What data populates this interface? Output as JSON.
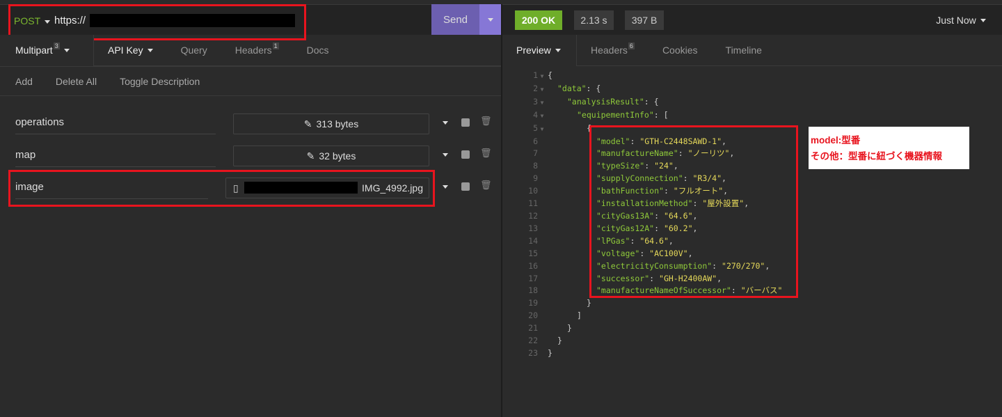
{
  "request": {
    "method": "POST",
    "url": "https://",
    "send_label": "Send"
  },
  "response_meta": {
    "status": "200 OK",
    "time": "2.13 s",
    "size": "397 B",
    "history": "Just Now",
    "status_color": "#6fae2a"
  },
  "request_tabs": [
    {
      "label": "Multipart",
      "count": "3"
    },
    {
      "label": "API Key"
    },
    {
      "label": "Query"
    },
    {
      "label": "Headers",
      "count": "1"
    },
    {
      "label": "Docs"
    }
  ],
  "response_tabs": [
    {
      "label": "Preview"
    },
    {
      "label": "Headers",
      "count": "6"
    },
    {
      "label": "Cookies"
    },
    {
      "label": "Timeline"
    }
  ],
  "toolbar": {
    "add": "Add",
    "delete_all": "Delete All",
    "toggle_description": "Toggle Description"
  },
  "params": [
    {
      "name": "operations",
      "value": "313 bytes"
    },
    {
      "name": "map",
      "value": "32 bytes"
    },
    {
      "name": "image",
      "value": "IMG_4992.jpg"
    }
  ],
  "code_lines": [
    {
      "n": "1",
      "f": 1,
      "ind": 0,
      "p": "{"
    },
    {
      "n": "2",
      "f": 1,
      "ind": 1,
      "k": "\"data\"",
      "p": ": {"
    },
    {
      "n": "3",
      "f": 1,
      "ind": 2,
      "k": "\"analysisResult\"",
      "p": ": {"
    },
    {
      "n": "4",
      "f": 1,
      "ind": 3,
      "k": "\"equipementInfo\"",
      "p": ": ["
    },
    {
      "n": "5",
      "f": 1,
      "ind": 4,
      "p": "{"
    },
    {
      "n": "6",
      "ind": 5,
      "k": "\"model\"",
      "v": "\"GTH-C2448SAWD-1\"",
      "p2": ","
    },
    {
      "n": "7",
      "ind": 5,
      "k": "\"manufactureName\"",
      "v": "\"ノーリツ\"",
      "p2": ","
    },
    {
      "n": "8",
      "ind": 5,
      "k": "\"typeSize\"",
      "v": "\"24\"",
      "p2": ","
    },
    {
      "n": "9",
      "ind": 5,
      "k": "\"supplyConnection\"",
      "v": "\"R3/4\"",
      "p2": ","
    },
    {
      "n": "10",
      "ind": 5,
      "k": "\"bathFunction\"",
      "v": "\"フルオート\"",
      "p2": ","
    },
    {
      "n": "11",
      "ind": 5,
      "k": "\"installationMethod\"",
      "v": "\"屋外設置\"",
      "p2": ","
    },
    {
      "n": "12",
      "ind": 5,
      "k": "\"cityGas13A\"",
      "v": "\"64.6\"",
      "p2": ","
    },
    {
      "n": "13",
      "ind": 5,
      "k": "\"cityGas12A\"",
      "v": "\"60.2\"",
      "p2": ","
    },
    {
      "n": "14",
      "ind": 5,
      "k": "\"lPGas\"",
      "v": "\"64.6\"",
      "p2": ","
    },
    {
      "n": "15",
      "ind": 5,
      "k": "\"voltage\"",
      "v": "\"AC100V\"",
      "p2": ","
    },
    {
      "n": "16",
      "ind": 5,
      "k": "\"electricityConsumption\"",
      "v": "\"270/270\"",
      "p2": ","
    },
    {
      "n": "17",
      "ind": 5,
      "k": "\"successor\"",
      "v": "\"GH-H2400AW\"",
      "p2": ","
    },
    {
      "n": "18",
      "ind": 5,
      "k": "\"manufactureNameOfSuccessor\"",
      "v": "\"バーバス\""
    },
    {
      "n": "19",
      "ind": 4,
      "p": "}"
    },
    {
      "n": "20",
      "ind": 3,
      "p": "]"
    },
    {
      "n": "21",
      "ind": 2,
      "p": "}"
    },
    {
      "n": "22",
      "ind": 1,
      "p": "}"
    },
    {
      "n": "23",
      "ind": 0,
      "p": "}"
    }
  ],
  "annotation": {
    "line1": "model:型番",
    "line2": "その他：型番に紐づく機器情報"
  }
}
